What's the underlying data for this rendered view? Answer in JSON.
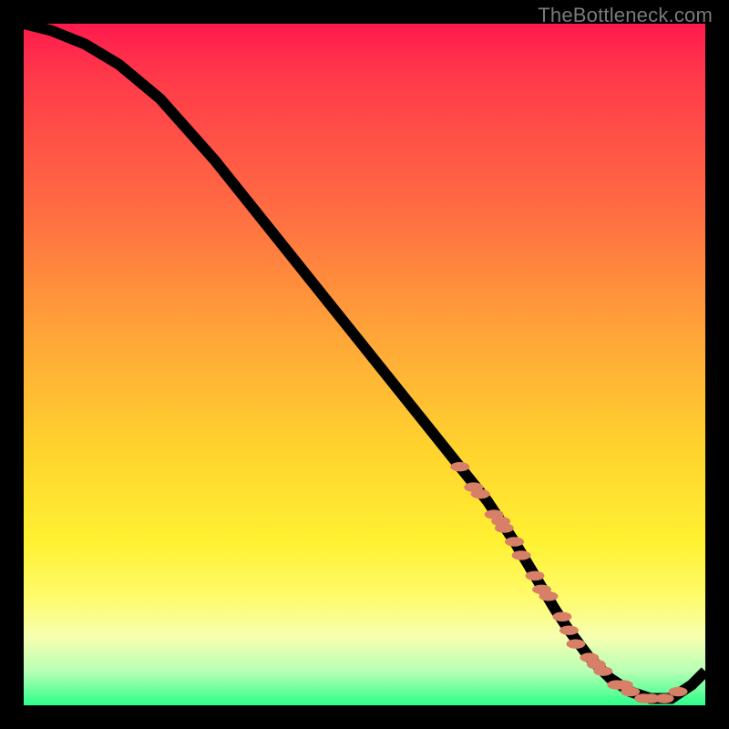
{
  "watermark": "TheBottleneck.com",
  "chart_data": {
    "type": "line",
    "title": "",
    "xlabel": "",
    "ylabel": "",
    "xlim": [
      0,
      100
    ],
    "ylim": [
      0,
      100
    ],
    "series": [
      {
        "name": "bottleneck-curve",
        "x": [
          0,
          4,
          9,
          14,
          20,
          28,
          36,
          44,
          52,
          60,
          64,
          68,
          70,
          72,
          75,
          78,
          80,
          83,
          86,
          89,
          92,
          95,
          98,
          100
        ],
        "y": [
          100,
          99,
          97,
          94,
          89,
          80,
          70,
          60,
          50,
          40,
          35,
          30,
          27,
          24,
          19,
          14,
          11,
          7,
          4,
          2,
          1,
          1,
          3,
          5
        ]
      }
    ],
    "markers": {
      "name": "highlight-points",
      "x": [
        64,
        66,
        67,
        69,
        70,
        70.5,
        72,
        73,
        75,
        76,
        77,
        79,
        80,
        81,
        83,
        84,
        85,
        87,
        88,
        89,
        91,
        92,
        94,
        96
      ],
      "y": [
        35,
        32,
        31,
        28,
        27,
        26,
        24,
        22,
        19,
        17,
        16,
        13,
        11,
        9,
        7,
        6,
        5,
        3,
        3,
        2,
        1,
        1,
        1,
        2
      ]
    },
    "background_gradient": {
      "orientation": "vertical",
      "stops": [
        {
          "pos": 0.0,
          "color": "#ff1a4d"
        },
        {
          "pos": 0.28,
          "color": "#ff6e42"
        },
        {
          "pos": 0.62,
          "color": "#ffd22e"
        },
        {
          "pos": 0.84,
          "color": "#fffb6a"
        },
        {
          "pos": 1.0,
          "color": "#2eff8a"
        }
      ]
    }
  }
}
